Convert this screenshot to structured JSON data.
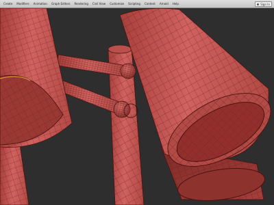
{
  "menubar": {
    "items": [
      {
        "label": "Create"
      },
      {
        "label": "Modifiers"
      },
      {
        "label": "Animation"
      },
      {
        "label": "Graph Editors"
      },
      {
        "label": "Rendering"
      },
      {
        "label": "Civil View"
      },
      {
        "label": "Customize"
      },
      {
        "label": "Scripting"
      },
      {
        "label": "Content"
      },
      {
        "label": "Arnold"
      },
      {
        "label": "Help"
      }
    ],
    "signin_label": "Sign In",
    "signin_icon": "user-icon"
  },
  "viewport": {
    "background_color": "#2e2e2e",
    "mesh_color": "#c0504b",
    "wire_color": "#5a1614",
    "selection_edge_color": "#e0a040",
    "objects": [
      "lamp-shade-left",
      "lamp-shade-right",
      "lamp-shade-bottom-left",
      "lamp-shade-bottom-right",
      "lamp-stem",
      "lamp-arm-upper",
      "lamp-arm-lower",
      "lamp-joint-upper",
      "lamp-joint-lower"
    ]
  }
}
